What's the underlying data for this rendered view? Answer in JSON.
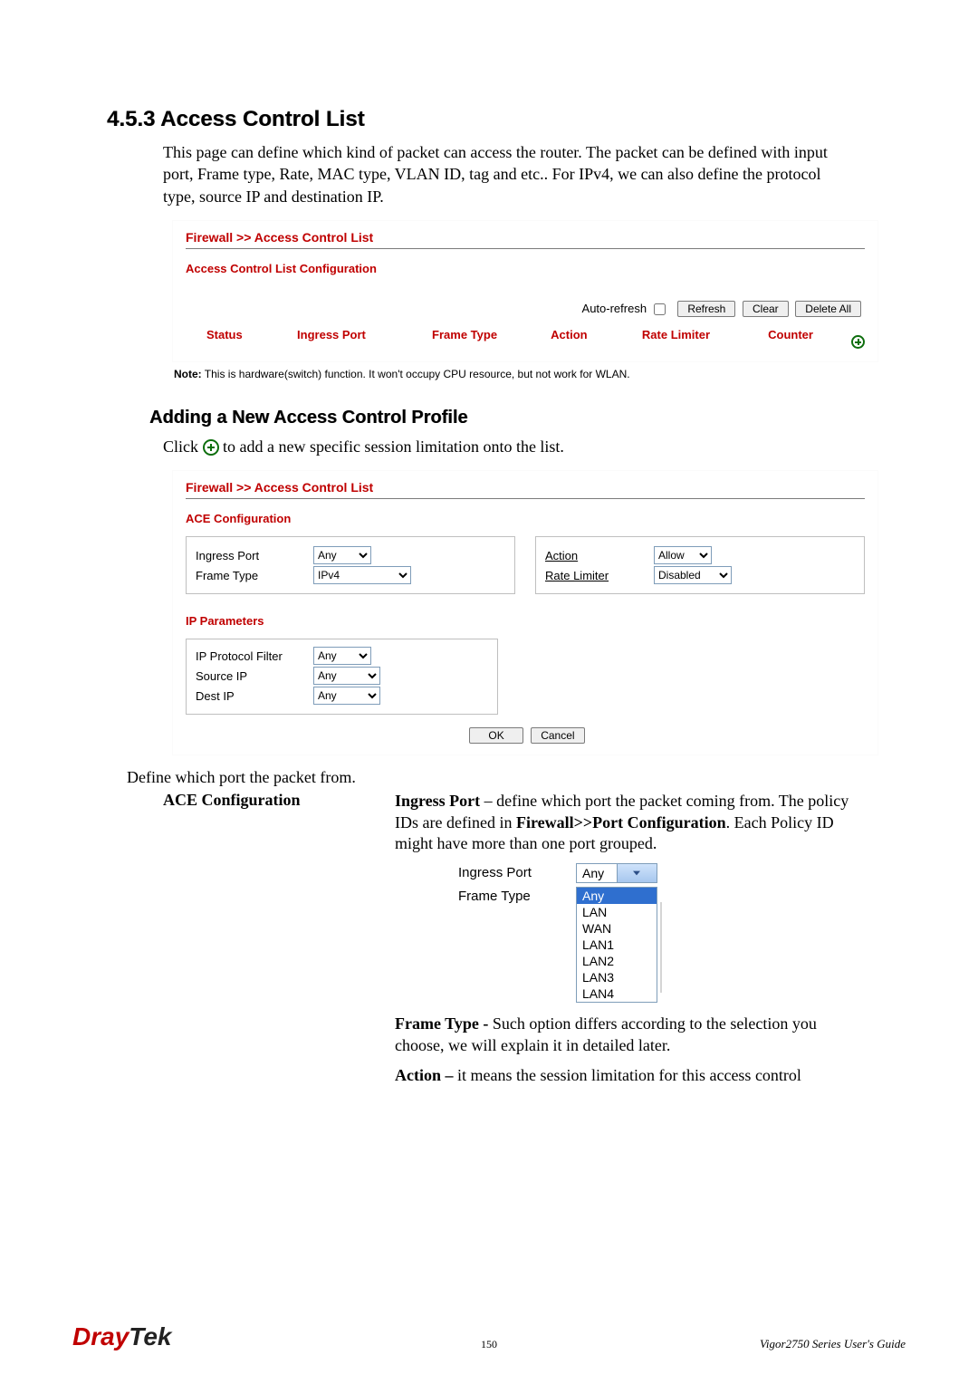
{
  "section": {
    "number": "4.5.3",
    "title": "Access Control List"
  },
  "intro": "This page can define which kind of packet can access the router. The packet can be defined with input port, Frame type, Rate, MAC type, VLAN ID, tag and etc.. For IPv4, we can also define the protocol type, source IP and destination IP.",
  "panel1": {
    "breadcrumb": "Firewall >> Access Control List",
    "heading": "Access Control List Configuration",
    "auto_refresh_label": "Auto-refresh",
    "refresh": "Refresh",
    "clear": "Clear",
    "delete_all": "Delete All",
    "cols": {
      "status": "Status",
      "ingress": "Ingress Port",
      "frame": "Frame Type",
      "action": "Action",
      "rate": "Rate Limiter",
      "counter": "Counter"
    }
  },
  "note_label": "Note:",
  "note_text": " This is hardware(switch) function. It won't occupy CPU resource, but not work for WLAN.",
  "sub_heading": "Adding a New Access Control Profile",
  "click_pre": "Click  ",
  "click_post": "  to add a new specific session limitation onto the list.",
  "panel2": {
    "breadcrumb": "Firewall >> Access Control List",
    "ace_heading": "ACE Configuration",
    "ingress_label": "Ingress Port",
    "ingress_value": "Any",
    "frame_label": "Frame Type",
    "frame_value": "IPv4",
    "action_label": "Action",
    "action_value": "Allow",
    "rate_label": "Rate Limiter",
    "rate_value": "Disabled",
    "ip_heading": "IP Parameters",
    "ipfilter_label": "IP Protocol Filter",
    "ipfilter_value": "Any",
    "srcip_label": "Source IP",
    "srcip_value": "Any",
    "dstip_label": "Dest IP",
    "dstip_value": "Any",
    "ok": "OK",
    "cancel": "Cancel"
  },
  "define_line": "Define which port the packet from.",
  "def_term": "ACE Configuration",
  "def_ingress_bold": "Ingress Port",
  "def_ingress_rest": " – define which port the packet coming from. The policy IDs are defined in ",
  "def_ingress_bold2": "Firewall>>Port Configuration",
  "def_ingress_rest2": ". Each Policy ID might have more than one port grouped.",
  "mini": {
    "ingress_label": "Ingress Port",
    "ingress_value": "Any",
    "frame_label": "Frame Type",
    "options": [
      "Any",
      "LAN",
      "WAN",
      "LAN1",
      "LAN2",
      "LAN3",
      "LAN4"
    ]
  },
  "def_frame_bold": "Frame Type - ",
  "def_frame_rest": "Such option differs according to the selection you choose, we will explain it in detailed later.",
  "def_action_bold": "Action – ",
  "def_action_rest": "it means the session limitation for this access control",
  "footer": {
    "page": "150",
    "guide": "Vigor2750  Series  User's  Guide",
    "logo1": "Dray",
    "logo2": "Tek"
  }
}
